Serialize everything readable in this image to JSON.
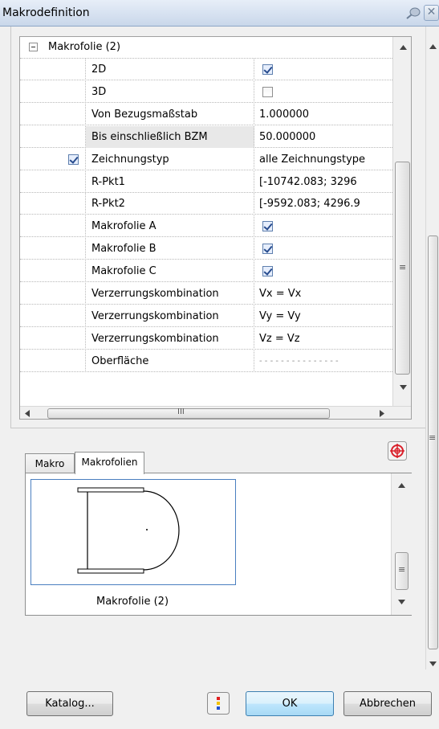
{
  "window": {
    "title": "Makrodefinition",
    "close_label": "✕"
  },
  "grid": {
    "group_label": "Makrofolie (2)",
    "rows": [
      {
        "name": "2D",
        "value": "",
        "checkbox": true,
        "checked": true
      },
      {
        "name": "3D",
        "value": "",
        "checkbox": true,
        "checked": false
      },
      {
        "name": "Von Bezugsmaßstab",
        "value": "1.000000"
      },
      {
        "name": "Bis einschließlich BZM",
        "value": "50.000000",
        "selected": true
      },
      {
        "name": "Zeichnungstyp",
        "value": "alle Zeichnungstype",
        "gutter_checked": true
      },
      {
        "name": "R-Pkt1",
        "value": "[-10742.083; 3296"
      },
      {
        "name": "R-Pkt2",
        "value": "[-9592.083; 4296.9"
      },
      {
        "name": "Makrofolie A",
        "value": "",
        "checkbox": true,
        "checked": true
      },
      {
        "name": "Makrofolie B",
        "value": "",
        "checkbox": true,
        "checked": true
      },
      {
        "name": "Makrofolie C",
        "value": "",
        "checkbox": true,
        "checked": true
      },
      {
        "name": "Verzerrungskombination",
        "value": "Vx = Vx"
      },
      {
        "name": "Verzerrungskombination",
        "value": "Vy = Vy"
      },
      {
        "name": "Verzerrungskombination",
        "value": "Vz = Vz"
      },
      {
        "name": "Oberfläche",
        "value": "- - - - - - - - - - - - - - -"
      }
    ],
    "hscroll_grip": "III",
    "vscroll_grip": "≡"
  },
  "tabs": [
    {
      "label": "Makro",
      "active": false
    },
    {
      "label": "Makrofolien",
      "active": true
    }
  ],
  "preview": {
    "caption": "Makrofolie (2)"
  },
  "buttons": {
    "catalog": "Katalog...",
    "ok": "OK",
    "cancel": "Abbrechen"
  },
  "colors": {
    "accent": "#3c7fb1",
    "checkmark": "#284c8e",
    "target_icon": "#d9202a"
  }
}
